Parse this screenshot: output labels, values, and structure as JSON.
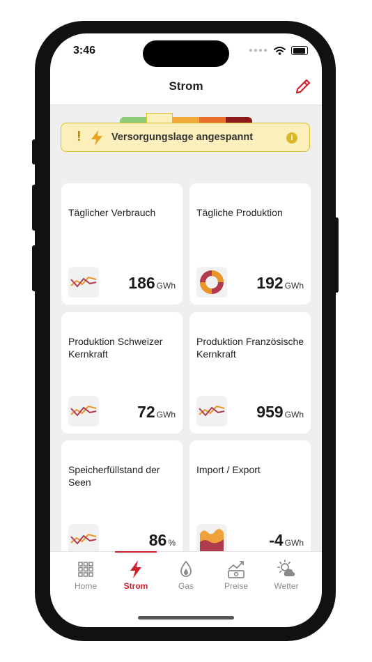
{
  "status": {
    "time": "3:46"
  },
  "nav": {
    "title": "Strom"
  },
  "colors": {
    "accent": "#d0202e",
    "warning_bg": "#fbefbb",
    "warning_border": "#d9bd2c"
  },
  "level_bar_colors": [
    "#8fc97a",
    "#f0c85a",
    "#f2a93a",
    "#e8702a",
    "#8b1a1a"
  ],
  "banner": {
    "icon_excl": "!",
    "icon": "lightning-icon",
    "text": "Versorgungslage angespannt",
    "info_icon": "i"
  },
  "cards": [
    {
      "title": "Täglicher Verbrauch",
      "value": "186",
      "unit": "GWh",
      "icon": "line-chart-icon"
    },
    {
      "title": "Tägliche Produktion",
      "value": "192",
      "unit": "GWh",
      "icon": "donut-chart-icon"
    },
    {
      "title": "Produktion Schweizer Kernkraft",
      "value": "72",
      "unit": "GWh",
      "icon": "line-chart-icon"
    },
    {
      "title": "Produktion Französische Kernkraft",
      "value": "959",
      "unit": "GWh",
      "icon": "line-chart-icon"
    },
    {
      "title": "Speicherfüllstand der Seen",
      "value": "86",
      "unit": "%",
      "icon": "line-chart-icon"
    },
    {
      "title": "Import / Export",
      "value": "-4",
      "unit": "GWh",
      "icon": "area-chart-icon"
    }
  ],
  "tabs": [
    {
      "label": "Home",
      "icon": "grid-icon"
    },
    {
      "label": "Strom",
      "icon": "lightning-icon",
      "active": true
    },
    {
      "label": "Gas",
      "icon": "flame-icon"
    },
    {
      "label": "Preise",
      "icon": "price-chart-icon"
    },
    {
      "label": "Wetter",
      "icon": "weather-icon"
    }
  ]
}
